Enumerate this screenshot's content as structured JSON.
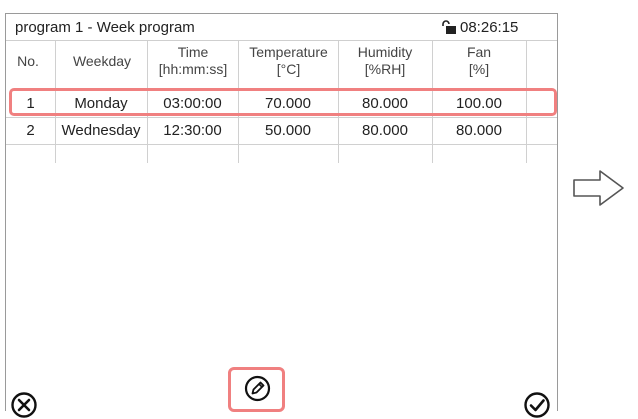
{
  "window": {
    "title": "program 1 - Week program",
    "time": "08:26:15",
    "lock_icon": "unlocked-lock-icon"
  },
  "table": {
    "headers": [
      {
        "line1": "No.",
        "line2": ""
      },
      {
        "line1": "Weekday",
        "line2": ""
      },
      {
        "line1": "Time",
        "line2": "[hh:mm:ss]"
      },
      {
        "line1": "Temperature",
        "line2": "[°C]"
      },
      {
        "line1": "Humidity",
        "line2": "[%RH]"
      },
      {
        "line1": "Fan",
        "line2": "[%]"
      }
    ],
    "rows": [
      {
        "no": "1",
        "weekday": "Monday",
        "time": "03:00:00",
        "temperature": "70.000",
        "humidity": "80.000",
        "fan": "100.00"
      },
      {
        "no": "2",
        "weekday": "Wednesday",
        "time": "12:30:00",
        "temperature": "50.000",
        "humidity": "80.000",
        "fan": "80.000"
      }
    ],
    "selected_row": 1
  },
  "buttons": {
    "close_icon": "close-circle-icon",
    "edit_icon": "edit-pen-icon",
    "ok_icon": "check-circle-icon"
  },
  "annotation": {
    "arrow_icon": "right-arrow-icon"
  },
  "colors": {
    "highlight": "#f08080",
    "grid": "#d0d0d0"
  }
}
